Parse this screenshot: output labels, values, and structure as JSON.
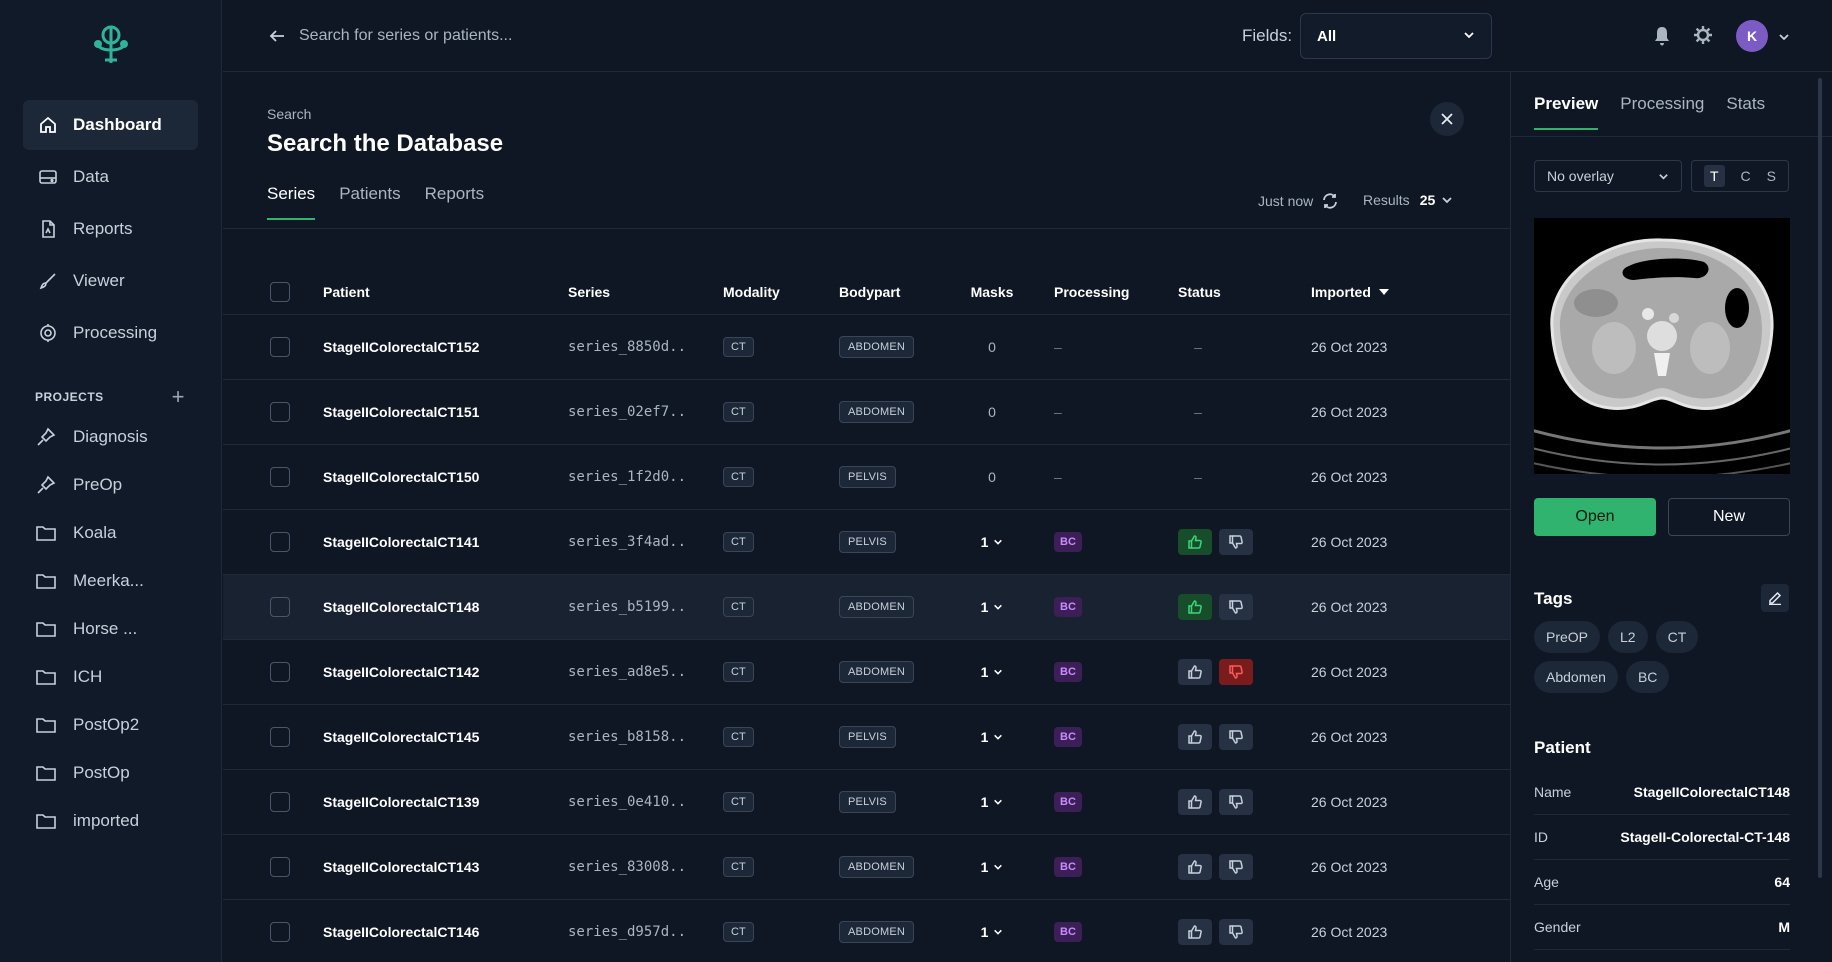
{
  "colors": {
    "accent": "#2fb36f",
    "bc_badge": "#3c1f56",
    "thumb_up_active": "#174d2b",
    "thumb_down_active": "#7a1c1c"
  },
  "sidebar": {
    "nav": [
      {
        "label": "Dashboard",
        "icon": "home-icon",
        "active": true
      },
      {
        "label": "Data",
        "icon": "database-icon"
      },
      {
        "label": "Reports",
        "icon": "report-icon"
      },
      {
        "label": "Viewer",
        "icon": "brush-icon"
      },
      {
        "label": "Processing",
        "icon": "processing-icon"
      }
    ],
    "projects_label": "PROJECTS",
    "projects": [
      {
        "label": "Diagnosis",
        "icon": "pin-icon"
      },
      {
        "label": "PreOp",
        "icon": "pin-icon"
      },
      {
        "label": "Koala",
        "icon": "folder-icon"
      },
      {
        "label": "Meerka...",
        "icon": "folder-icon"
      },
      {
        "label": "Horse ...",
        "icon": "folder-icon"
      },
      {
        "label": "ICH",
        "icon": "folder-icon"
      },
      {
        "label": "PostOp2",
        "icon": "folder-icon"
      },
      {
        "label": "PostOp",
        "icon": "folder-icon"
      },
      {
        "label": "imported",
        "icon": "folder-icon"
      }
    ]
  },
  "topbar": {
    "search_placeholder": "Search for series or patients...",
    "fields_label": "Fields:",
    "fields_value": "All",
    "avatar_initial": "K"
  },
  "main": {
    "breadcrumb": "Search",
    "title": "Search the Database",
    "tabs": [
      "Series",
      "Patients",
      "Reports"
    ],
    "refresh_label": "Just now",
    "results_label": "Results",
    "results_value": "25",
    "columns": [
      "Patient",
      "Series",
      "Modality",
      "Bodypart",
      "Masks",
      "Processing",
      "Status",
      "Imported"
    ]
  },
  "rows": [
    {
      "patient": "StageIIColorectalCT152",
      "series": "series_8850d..",
      "modality": "CT",
      "bodypart": "ABDOMEN",
      "masks": "0",
      "processing": "–",
      "status": "–",
      "imported": "26 Oct 2023"
    },
    {
      "patient": "StageIIColorectalCT151",
      "series": "series_02ef7..",
      "modality": "CT",
      "bodypart": "ABDOMEN",
      "masks": "0",
      "processing": "–",
      "status": "–",
      "imported": "26 Oct 2023"
    },
    {
      "patient": "StageIIColorectalCT150",
      "series": "series_1f2d0..",
      "modality": "CT",
      "bodypart": "PELVIS",
      "masks": "0",
      "processing": "–",
      "status": "–",
      "imported": "26 Oct 2023"
    },
    {
      "patient": "StageIIColorectalCT141",
      "series": "series_3f4ad..",
      "modality": "CT",
      "bodypart": "PELVIS",
      "masks": "1",
      "processing": "BC",
      "status": "up",
      "imported": "26 Oct 2023"
    },
    {
      "patient": "StageIIColorectalCT148",
      "series": "series_b5199..",
      "modality": "CT",
      "bodypart": "ABDOMEN",
      "masks": "1",
      "processing": "BC",
      "status": "up",
      "imported": "26 Oct 2023",
      "highlight": true
    },
    {
      "patient": "StageIIColorectalCT142",
      "series": "series_ad8e5..",
      "modality": "CT",
      "bodypart": "ABDOMEN",
      "masks": "1",
      "processing": "BC",
      "status": "down",
      "imported": "26 Oct 2023"
    },
    {
      "patient": "StageIIColorectalCT145",
      "series": "series_b8158..",
      "modality": "CT",
      "bodypart": "PELVIS",
      "masks": "1",
      "processing": "BC",
      "status": "none",
      "imported": "26 Oct 2023"
    },
    {
      "patient": "StageIIColorectalCT139",
      "series": "series_0e410..",
      "modality": "CT",
      "bodypart": "PELVIS",
      "masks": "1",
      "processing": "BC",
      "status": "none",
      "imported": "26 Oct 2023"
    },
    {
      "patient": "StageIIColorectalCT143",
      "series": "series_83008..",
      "modality": "CT",
      "bodypart": "ABDOMEN",
      "masks": "1",
      "processing": "BC",
      "status": "none",
      "imported": "26 Oct 2023"
    },
    {
      "patient": "StageIIColorectalCT146",
      "series": "series_d957d..",
      "modality": "CT",
      "bodypart": "ABDOMEN",
      "masks": "1",
      "processing": "BC",
      "status": "none",
      "imported": "26 Oct 2023"
    }
  ],
  "panel": {
    "tabs": [
      "Preview",
      "Processing",
      "Stats"
    ],
    "overlay_value": "No overlay",
    "views": [
      "T",
      "C",
      "S"
    ],
    "open_label": "Open",
    "new_label": "New",
    "tags_title": "Tags",
    "tags": [
      "PreOP",
      "L2",
      "CT",
      "Abdomen",
      "BC"
    ],
    "patient_title": "Patient",
    "patient_fields": [
      {
        "key": "Name",
        "value": "StageIIColorectalCT148"
      },
      {
        "key": "ID",
        "value": "StageII-Colorectal-CT-148"
      },
      {
        "key": "Age",
        "value": "64"
      },
      {
        "key": "Gender",
        "value": "M"
      }
    ]
  }
}
